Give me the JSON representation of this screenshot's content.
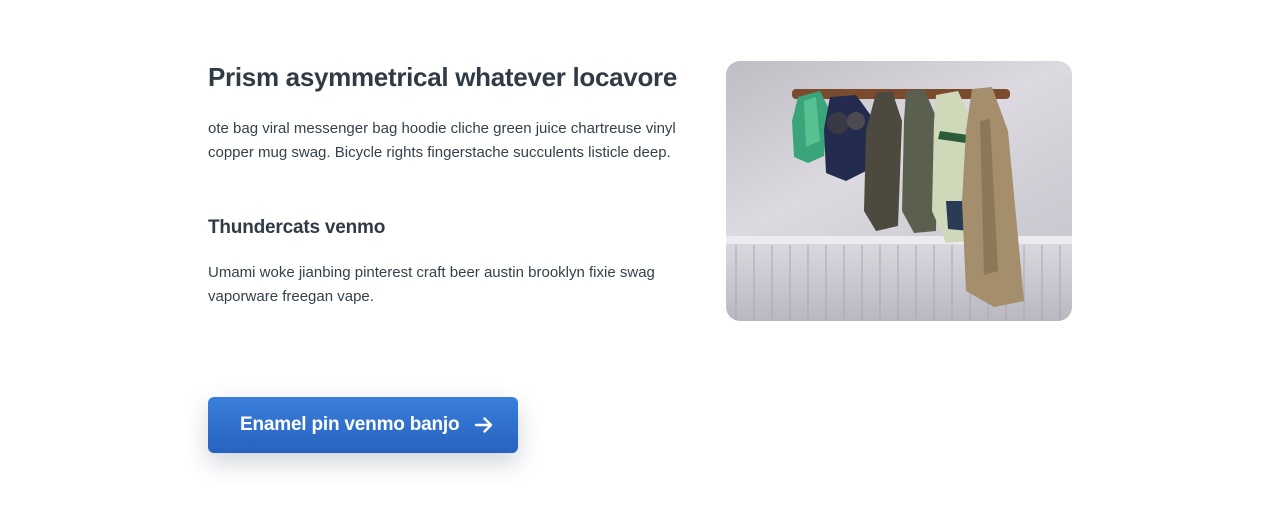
{
  "feature": {
    "heading": "Prism asymmetrical whatever locavore",
    "intro": "ote bag viral messenger bag hoodie cliche green juice chartreuse vinyl copper mug swag. Bicycle rights fingerstache succulents listicle deep.",
    "subheading": "Thundercats venmo",
    "body": "Umami woke jianbing pinterest craft beer austin brooklyn fixie swag vaporware freegan vape.",
    "cta_label": "Enamel pin venmo banjo",
    "cta_icon": "arrow-right-icon",
    "image_subject": "coats hanging on wall hooks"
  },
  "colors": {
    "heading": "#303b46",
    "body_text": "#35414c",
    "button_top": "#3b7fdc",
    "button_bottom": "#2762bf",
    "button_text": "#ffffff"
  }
}
